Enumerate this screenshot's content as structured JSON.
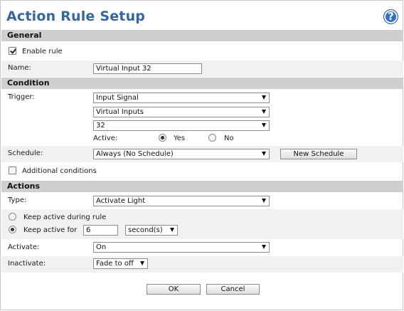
{
  "title": "Action Rule Setup",
  "help_icon": "?",
  "general": {
    "header": "General",
    "enable_rule_label": "Enable rule",
    "enable_rule_checked": true,
    "name_label": "Name:",
    "name_value": "Virtual Input 32"
  },
  "condition": {
    "header": "Condition",
    "trigger_label": "Trigger:",
    "trigger_value": "Input Signal",
    "trigger_sub_value": "Virtual Inputs",
    "trigger_port_value": "32",
    "active_label": "Active:",
    "active_yes": "Yes",
    "active_no": "No",
    "active_selected": "Yes",
    "schedule_label": "Schedule:",
    "schedule_value": "Always (No Schedule)",
    "new_schedule_label": "New Schedule",
    "additional_label": "Additional conditions",
    "additional_checked": false
  },
  "actions": {
    "header": "Actions",
    "type_label": "Type:",
    "type_value": "Activate Light",
    "keep_during_label": "Keep active during rule",
    "keep_for_label": "Keep active for",
    "keep_for_value": "6",
    "keep_for_unit": "second(s)",
    "keep_selected": "for",
    "activate_label": "Activate:",
    "activate_value": "On",
    "inactivate_label": "Inactivate:",
    "inactivate_value": "Fade to off"
  },
  "footer": {
    "ok_label": "OK",
    "cancel_label": "Cancel"
  }
}
